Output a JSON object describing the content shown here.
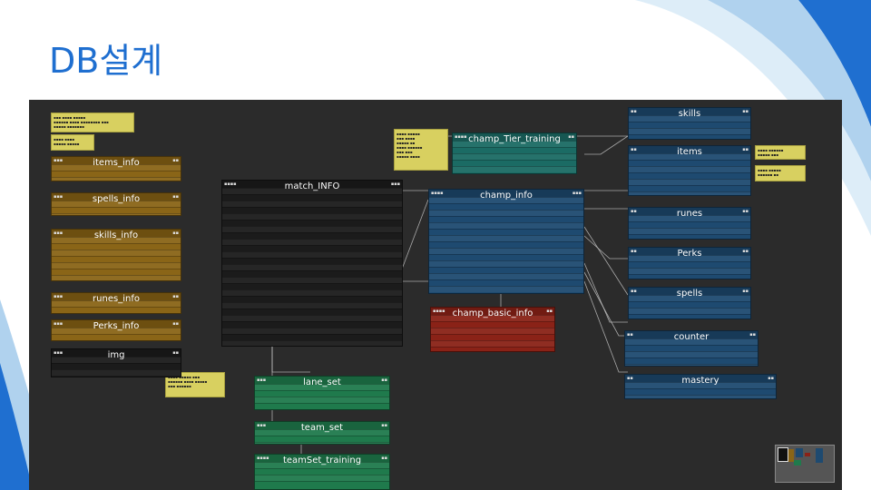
{
  "slide": {
    "title": "DB설계"
  },
  "colors": {
    "title": "#1f6fd0",
    "canvas": "#2b2b2b",
    "gold": "#8a6517",
    "blue": "#1e4a70",
    "green": "#1f7a4c",
    "red": "#8a2217",
    "teal": "#1b6b64",
    "note": "#d8d060"
  },
  "tables": {
    "items_info": "items_info",
    "spells_info": "spells_info",
    "skills_info": "skills_info",
    "runes_info": "runes_info",
    "perks_info": "Perks_info",
    "img": "img",
    "match_info": "match_INFO",
    "champ_tier_training": "champ_Tier_training",
    "champ_info": "champ_info",
    "champ_basic_info": "champ_basic_info",
    "lane_set": "lane_set",
    "team_set": "team_set",
    "team_set_training": "teamSet_training",
    "skills": "skills",
    "items": "items",
    "runes": "runes",
    "perks": "Perks",
    "spells": "spells",
    "counter": "counter",
    "mastery": "mastery"
  }
}
